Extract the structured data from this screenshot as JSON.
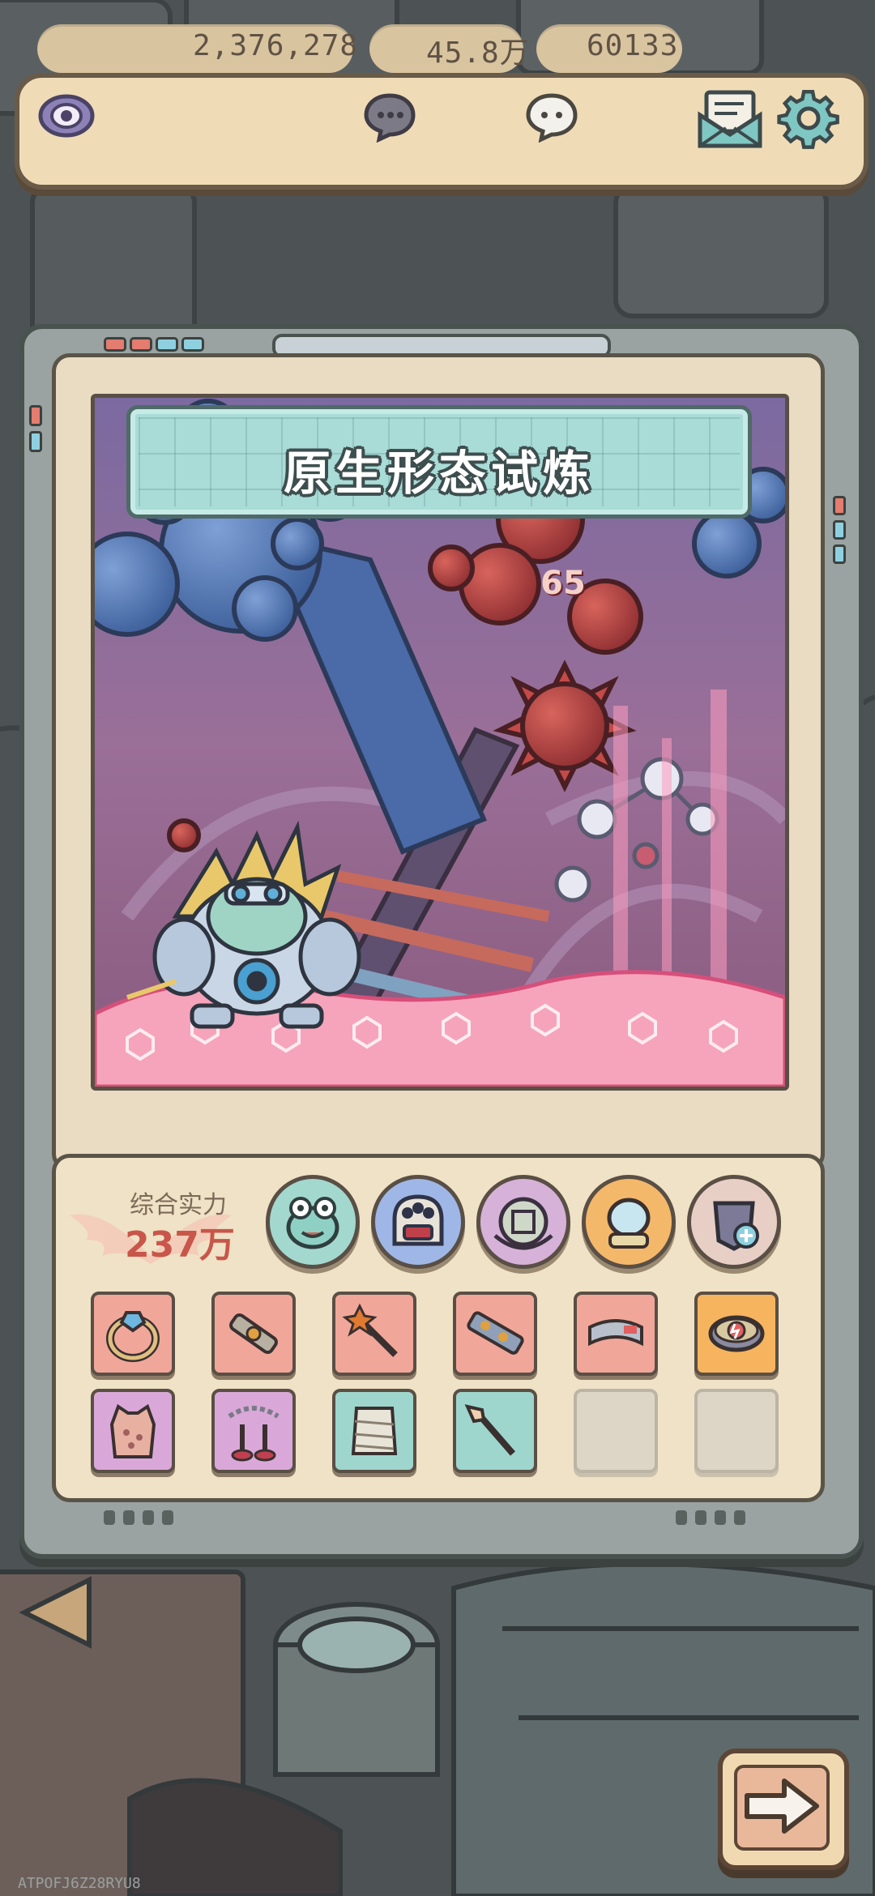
{
  "resources": {
    "views": {
      "icon": "eye-icon",
      "value": "2,376,278"
    },
    "dark_bubble": {
      "icon": "dark-speech-bubble-icon",
      "value": "45.8万"
    },
    "light_bubble": {
      "icon": "light-speech-bubble-icon",
      "value": "60133"
    }
  },
  "header_buttons": {
    "mail": "mail-icon",
    "settings": "gear-icon"
  },
  "stage": {
    "title": "原生形态试炼",
    "enemy_marker": "65"
  },
  "power": {
    "label": "综合实力",
    "value": "237万"
  },
  "skills": [
    "alien-face-icon",
    "many-eyed-monster-icon",
    "mind-shield-icon",
    "crystal-mirror-icon",
    "armor-plus-icon"
  ],
  "equipment": [
    {
      "icon": "gem-ring-icon",
      "color": "#f0a79a"
    },
    {
      "icon": "blaster-gun-icon",
      "color": "#f0a79a"
    },
    {
      "icon": "star-staff-icon",
      "color": "#f0a79a"
    },
    {
      "icon": "laser-rifle-icon",
      "color": "#f0a79a"
    },
    {
      "icon": "metal-cuff-icon",
      "color": "#f0a79a"
    },
    {
      "icon": "lightning-bracelet-icon",
      "color": "#f6b45e"
    },
    {
      "icon": "vest-armor-icon",
      "color": "#d9a8d8"
    },
    {
      "icon": "chain-hammer-icon",
      "color": "#d9a8d8"
    },
    {
      "icon": "bandage-armor-icon",
      "color": "#9ed6cd"
    },
    {
      "icon": "pointing-wand-icon",
      "color": "#9ed6cd"
    },
    {
      "icon": "",
      "color": ""
    },
    {
      "icon": "",
      "color": ""
    }
  ],
  "next_button": "arrow-right-icon",
  "watermark": "ATPOFJ6Z28RYU8"
}
